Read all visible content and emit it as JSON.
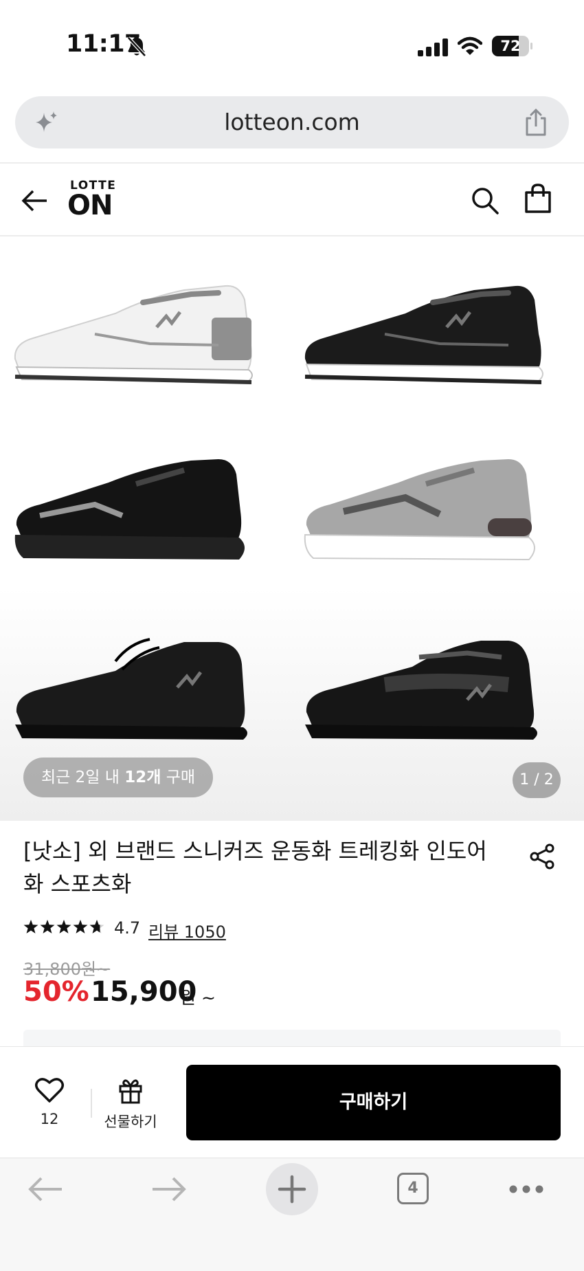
{
  "status_bar": {
    "time": "11:17",
    "battery": "72",
    "battery_level": 0.72
  },
  "browser": {
    "url": "lotteon.com",
    "tab_count": "4"
  },
  "site": {
    "logo_top": "LOTTE",
    "logo_bottom": "ON"
  },
  "gallery": {
    "recent_prefix": "최근 2일 내 ",
    "recent_count": "12개",
    "recent_suffix": " 구매",
    "counter": "1 / 2"
  },
  "product": {
    "title": "[낫소] 외 브랜드 스니커즈 운동화 트레킹화 인도어화 스포츠화",
    "rating": "4.7",
    "rating_value": 4.7,
    "review_label": "리뷰 1050",
    "original_price": "31,800원~",
    "discount": "50%",
    "price": "15,900",
    "price_unit": "원 ~"
  },
  "actions": {
    "like_count": "12",
    "gift_label": "선물하기",
    "buy_label": "구매하기"
  },
  "colors": {
    "accent_red": "#e4252d",
    "buy_button": "#000000"
  }
}
